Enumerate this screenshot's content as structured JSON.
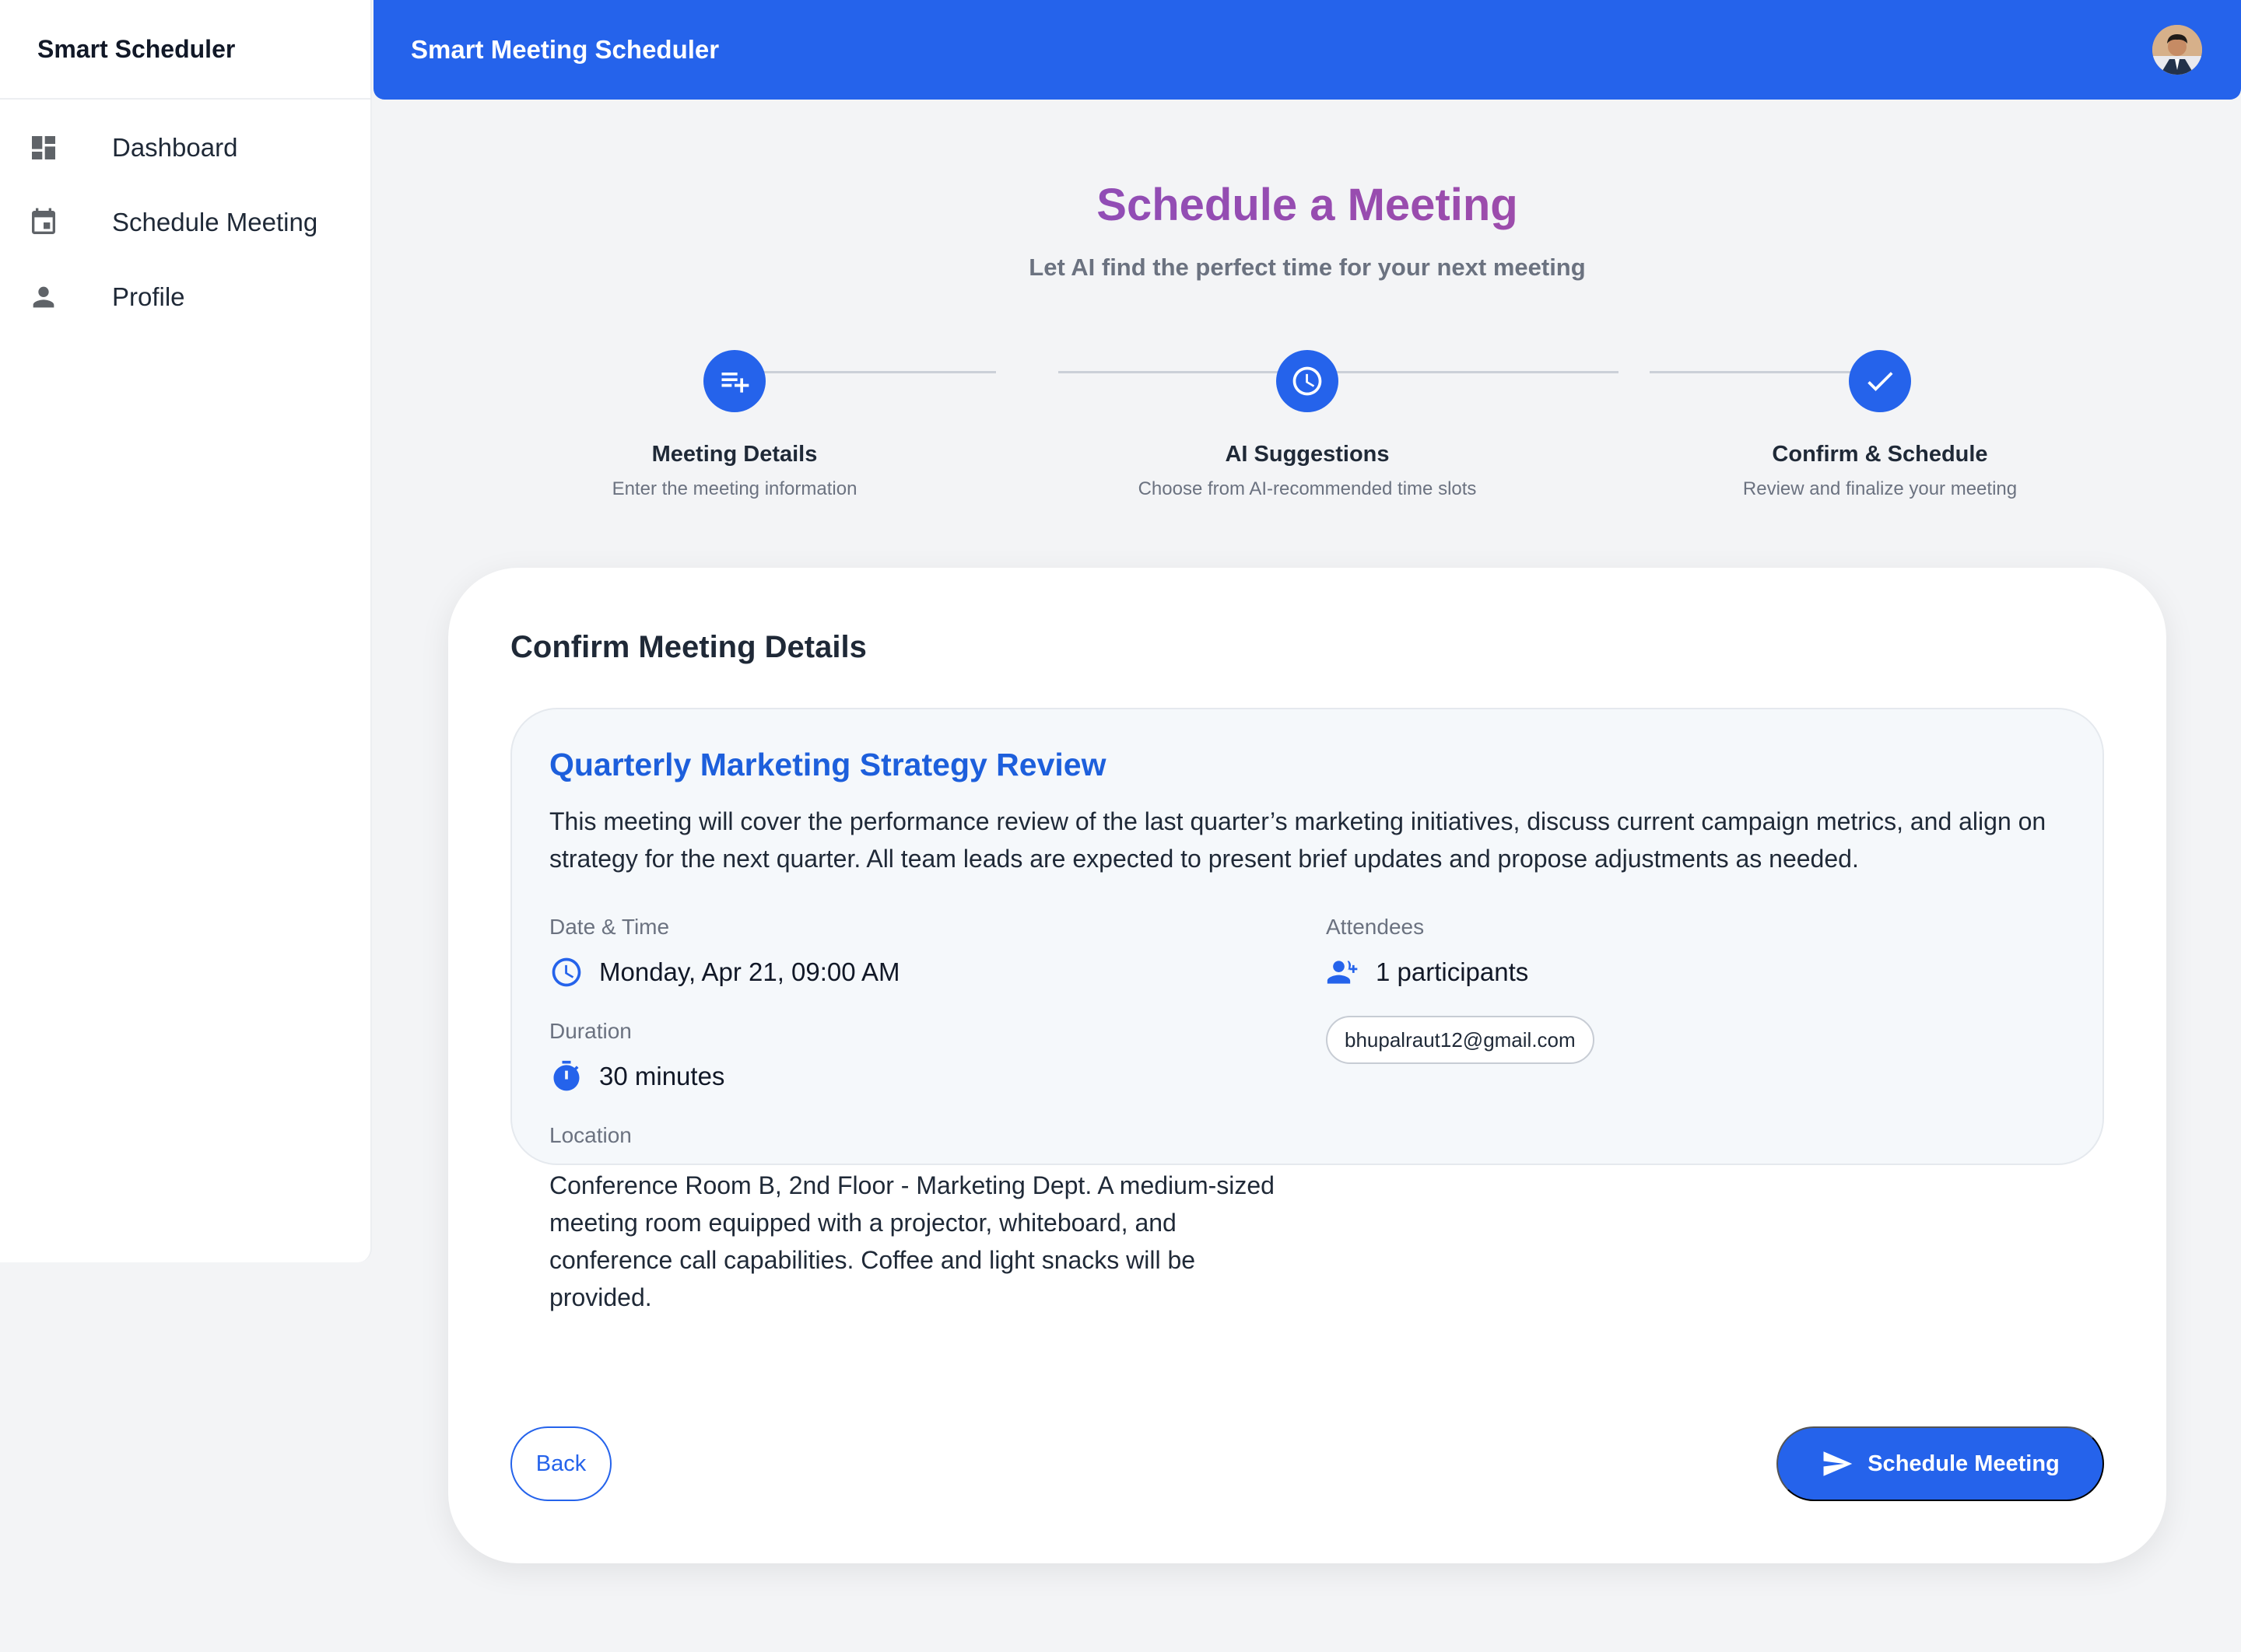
{
  "sidebar": {
    "brand": "Smart Scheduler",
    "items": [
      {
        "label": "Dashboard",
        "icon": "dashboard-icon"
      },
      {
        "label": "Schedule Meeting",
        "icon": "calendar-icon"
      },
      {
        "label": "Profile",
        "icon": "person-icon"
      }
    ]
  },
  "topbar": {
    "title": "Smart Meeting Scheduler",
    "accent": "#2563eb"
  },
  "header": {
    "title": "Schedule a Meeting",
    "subtitle": "Let AI find the perfect time for your next meeting"
  },
  "stepper": {
    "steps": [
      {
        "title": "Meeting Details",
        "desc": "Enter the meeting information",
        "icon": "playlist-add-icon"
      },
      {
        "title": "AI Suggestions",
        "desc": "Choose from AI-recommended time slots",
        "icon": "clock-icon"
      },
      {
        "title": "Confirm & Schedule",
        "desc": "Review and finalize your meeting",
        "icon": "check-icon"
      }
    ]
  },
  "card": {
    "heading": "Confirm Meeting Details",
    "meeting": {
      "title": "Quarterly Marketing Strategy Review",
      "description": "This meeting will cover the performance review of the last quarter’s marketing initiatives, discuss current campaign metrics, and align on strategy for the next quarter. All team leads are expected to present brief updates and propose adjustments as needed.",
      "datetime_label": "Date & Time",
      "datetime": "Monday, Apr 21, 09:00 AM",
      "duration_label": "Duration",
      "duration": "30 minutes",
      "location_label": "Location",
      "location": "Conference Room B, 2nd Floor - Marketing Dept. A medium-sized meeting room equipped with a projector, whiteboard, and conference call capabilities. Coffee and light snacks will be provided.",
      "attendees_label": "Attendees",
      "attendees_count": "1 participants",
      "attendees": [
        "bhupalraut12@gmail.com"
      ]
    },
    "back_label": "Back",
    "schedule_label": "Schedule Meeting"
  }
}
